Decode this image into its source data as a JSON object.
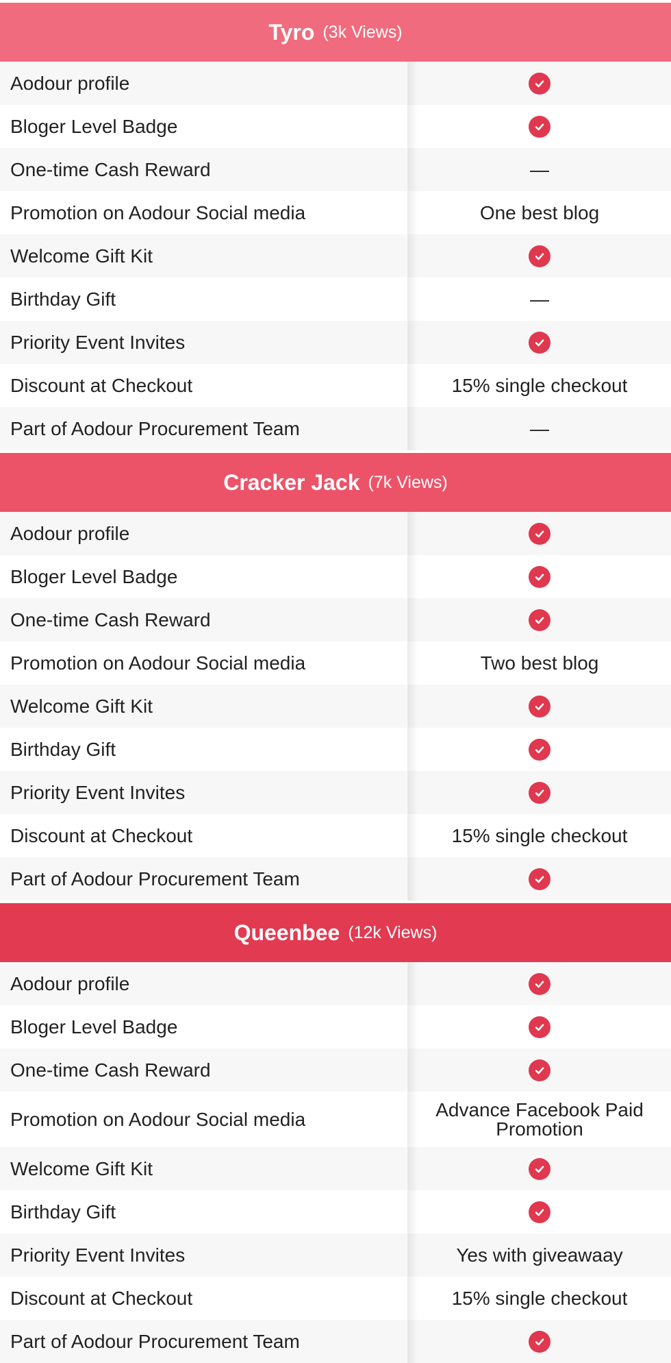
{
  "colors": {
    "tier_tyro": "#f06b7d",
    "tier_cracker_jack": "#ec5368",
    "tier_queenbee": "#e23a51",
    "check": "#e0384f"
  },
  "tiers": [
    {
      "name": "Tyro",
      "views": "(3k Views)",
      "color_key": "tier_tyro",
      "rows": [
        {
          "feature": "Aodour profile",
          "type": "check"
        },
        {
          "feature": "Bloger Level Badge",
          "type": "check"
        },
        {
          "feature": "One-time Cash Reward",
          "type": "dash",
          "text": "—"
        },
        {
          "feature": "Promotion on Aodour Social media",
          "type": "text",
          "text": "One best blog"
        },
        {
          "feature": "Welcome Gift Kit",
          "type": "check"
        },
        {
          "feature": "Birthday Gift",
          "type": "dash",
          "text": "—"
        },
        {
          "feature": "Priority Event Invites",
          "type": "check"
        },
        {
          "feature": "Discount at Checkout",
          "type": "text",
          "text": "15% single checkout"
        },
        {
          "feature": "Part of Aodour Procurement Team",
          "type": "dash",
          "text": "—"
        }
      ]
    },
    {
      "name": "Cracker Jack",
      "views": "(7k Views)",
      "color_key": "tier_cracker_jack",
      "rows": [
        {
          "feature": "Aodour profile",
          "type": "check"
        },
        {
          "feature": "Bloger Level Badge",
          "type": "check"
        },
        {
          "feature": "One-time Cash Reward",
          "type": "check"
        },
        {
          "feature": "Promotion on Aodour Social media",
          "type": "text",
          "text": "Two best blog"
        },
        {
          "feature": "Welcome Gift Kit",
          "type": "check"
        },
        {
          "feature": "Birthday Gift",
          "type": "check"
        },
        {
          "feature": "Priority Event Invites",
          "type": "check"
        },
        {
          "feature": "Discount at Checkout",
          "type": "text",
          "text": "15% single checkout"
        },
        {
          "feature": "Part of Aodour Procurement Team",
          "type": "check"
        }
      ]
    },
    {
      "name": "Queenbee",
      "views": "(12k Views)",
      "color_key": "tier_queenbee",
      "rows": [
        {
          "feature": "Aodour profile",
          "type": "check"
        },
        {
          "feature": "Bloger Level Badge",
          "type": "check"
        },
        {
          "feature": "One-time Cash Reward",
          "type": "check"
        },
        {
          "feature": "Promotion on Aodour Social media",
          "type": "text",
          "text": "Advance Facebook Paid Promotion",
          "tall": true
        },
        {
          "feature": "Welcome Gift Kit",
          "type": "check"
        },
        {
          "feature": "Birthday Gift",
          "type": "check"
        },
        {
          "feature": "Priority Event Invites",
          "type": "text",
          "text": "Yes with giveawaay"
        },
        {
          "feature": "Discount at Checkout",
          "type": "text",
          "text": "15% single checkout"
        },
        {
          "feature": "Part of Aodour Procurement Team",
          "type": "check"
        }
      ]
    }
  ]
}
